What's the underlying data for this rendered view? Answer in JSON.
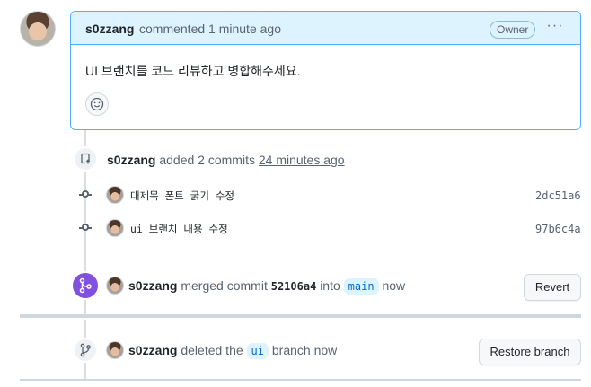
{
  "comment": {
    "author": "s0zzang",
    "action": "commented 1 minute ago",
    "badge": "Owner",
    "more_menu": "···",
    "body": "UI 브랜치를 코드 리뷰하고 병합해주세요."
  },
  "commits_event": {
    "author": "s0zzang",
    "action": "added 2 commits",
    "time": "24 minutes ago",
    "commits": [
      {
        "message": "대제목 폰트 굵기 수정",
        "sha": "2dc51a6"
      },
      {
        "message": "ui 브랜치 내용 수정",
        "sha": "97b6c4a"
      }
    ]
  },
  "merge_event": {
    "author": "s0zzang",
    "action": "merged commit",
    "commit": "52106a4",
    "into": "into",
    "branch": "main",
    "time": "now",
    "button": "Revert"
  },
  "delete_event": {
    "author": "s0zzang",
    "action": "deleted the",
    "branch": "ui",
    "suffix": "branch now",
    "button": "Restore branch"
  },
  "colors": {
    "accent": "#0969da",
    "merged": "#8250df",
    "header_bg": "#ddf4ff"
  }
}
